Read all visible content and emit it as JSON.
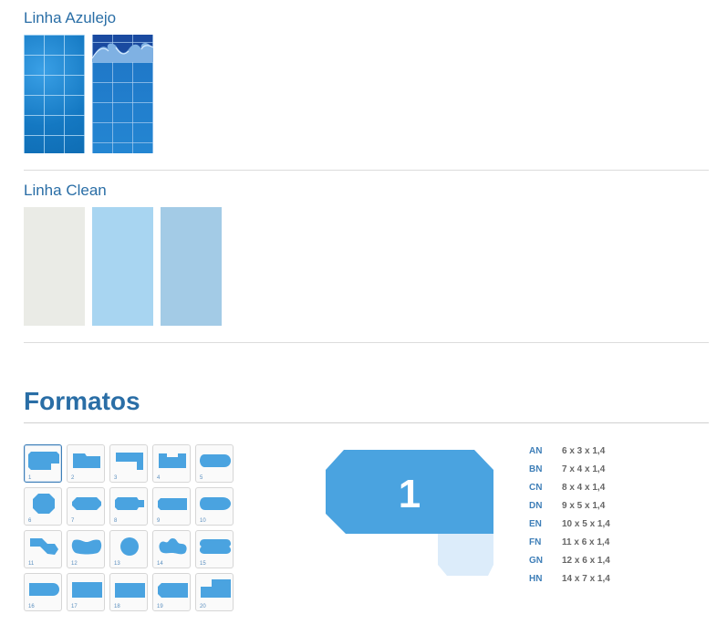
{
  "sections": {
    "azulejo": {
      "title": "Linha Azulejo"
    },
    "clean": {
      "title": "Linha Clean"
    }
  },
  "formatos": {
    "title": "Formatos",
    "selected": "1",
    "shapes": [
      {
        "num": "1"
      },
      {
        "num": "2"
      },
      {
        "num": "3"
      },
      {
        "num": "4"
      },
      {
        "num": "5"
      },
      {
        "num": "6"
      },
      {
        "num": "7"
      },
      {
        "num": "8"
      },
      {
        "num": "9"
      },
      {
        "num": "10"
      },
      {
        "num": "11"
      },
      {
        "num": "12"
      },
      {
        "num": "13"
      },
      {
        "num": "14"
      },
      {
        "num": "15"
      },
      {
        "num": "16"
      },
      {
        "num": "17"
      },
      {
        "num": "18"
      },
      {
        "num": "19"
      },
      {
        "num": "20"
      }
    ],
    "dimensions": [
      {
        "code": "AN",
        "size": "6 x 3 x 1,4"
      },
      {
        "code": "BN",
        "size": "7 x 4 x 1,4"
      },
      {
        "code": "CN",
        "size": "8 x 4 x 1,4"
      },
      {
        "code": "DN",
        "size": "9 x 5 x 1,4"
      },
      {
        "code": "EN",
        "size": "10 x 5 x 1,4"
      },
      {
        "code": "FN",
        "size": "11 x 6 x 1,4"
      },
      {
        "code": "GN",
        "size": "12 x 6 x 1,4"
      },
      {
        "code": "HN",
        "size": "14 x 7 x 1,4"
      }
    ]
  },
  "colors": {
    "accent": "#2a6ea6",
    "shape_fill": "#4aa3e0",
    "shape_shadow": "#dcecfa"
  }
}
